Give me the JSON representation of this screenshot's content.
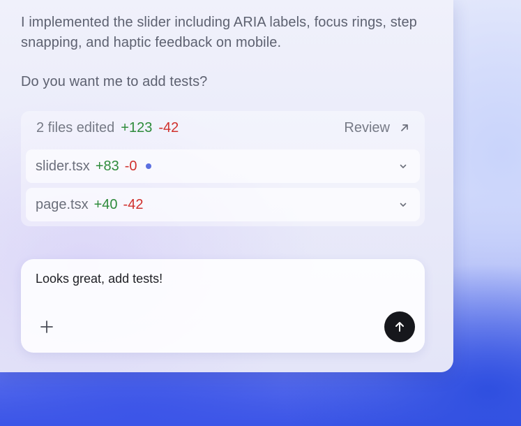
{
  "message": {
    "paragraph1": "I implemented the slider including ARIA labels, focus rings, step snapping, and haptic feedback on mobile.",
    "paragraph2": "Do you want me to add tests?"
  },
  "changes": {
    "summary": "2 files edited",
    "additions": "+123",
    "deletions": "-42",
    "review_label": "Review",
    "review_icon": "arrow-up-right-icon",
    "files": [
      {
        "name": "slider.tsx",
        "additions": "+83",
        "deletions": "-0",
        "unsaved_dot": true,
        "icon": "chevron-down-icon"
      },
      {
        "name": "page.tsx",
        "additions": "+40",
        "deletions": "-42",
        "unsaved_dot": false,
        "icon": "chevron-down-icon"
      }
    ]
  },
  "composer": {
    "text": "Looks great, add tests!",
    "attach_icon": "plus-icon",
    "send_icon": "arrow-up-icon"
  },
  "colors": {
    "additions": "#2e8b3b",
    "deletions": "#d0312d",
    "dot": "#5b6fe0",
    "send_button": "#16171c"
  }
}
